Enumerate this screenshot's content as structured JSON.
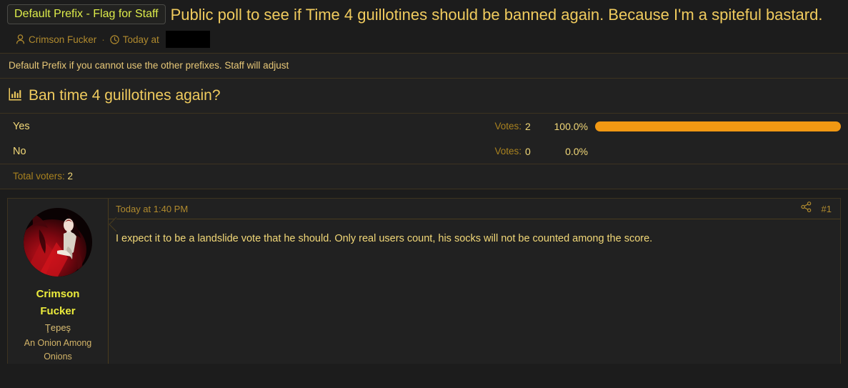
{
  "thread": {
    "prefix_label": "Default Prefix - Flag for Staff",
    "title": "Public poll to see if Time 4 guillotines should be banned again. Because I'm a spiteful bastard.",
    "author": "Crimson Fucker",
    "date_prefix": "Today at",
    "date_redacted": true,
    "prefix_description": "Default Prefix if you cannot use the other prefixes. Staff will adjust",
    "author_icon": "user-icon",
    "time_icon": "clock-icon"
  },
  "poll": {
    "icon": "poll-bar-chart-icon",
    "question": "Ban time 4 guillotines again?",
    "votes_label": "Votes:",
    "total_label": "Total voters:",
    "total_voters": "2",
    "bar_color": "#f19813",
    "options": [
      {
        "label": "Yes",
        "votes": "2",
        "percent": "100.0%",
        "percent_value": 100
      },
      {
        "label": "No",
        "votes": "0",
        "percent": "0.0%",
        "percent_value": 0
      }
    ]
  },
  "post": {
    "date": "Today at 1:40 PM",
    "number": "#1",
    "share_icon": "share-icon",
    "body": "I expect it to be a landslide vote that he should. Only real users count, his socks will not be counted among the score.",
    "user": {
      "name_line1": "Crimson",
      "name_line2": "Fucker",
      "title": "Ţepeş",
      "rank_line1": "An Onion Among",
      "rank_line2": "Onions",
      "avatar_icon": "user-avatar-image"
    }
  },
  "colors": {
    "background": "#1c1c1c",
    "panel": "#212121",
    "border": "#3d3320",
    "accent_title": "#f0cb5e",
    "accent_prefix": "#ddec4a",
    "accent_username": "#ecec3c",
    "muted_gold": "#b08a2e",
    "bar": "#f19813"
  }
}
